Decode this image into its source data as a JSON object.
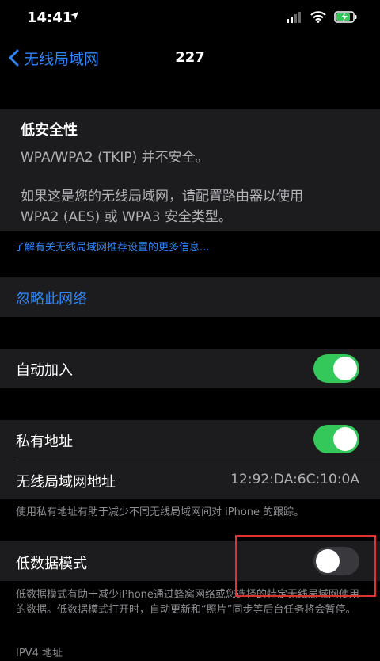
{
  "status_bar": {
    "time": "14:41",
    "location_icon": "location-arrow-icon",
    "signal_icon": "cellular-signal-icon",
    "wifi_icon": "wifi-icon",
    "battery_icon": "battery-charging-icon"
  },
  "nav": {
    "back_label": "无线局域网",
    "title": "227"
  },
  "security_warning": {
    "title": "低安全性",
    "line1": "WPA/WPA2 (TKIP) 并不安全。",
    "line2": "如果这是您的无线局域网，请配置路由器以使用",
    "line3": "WPA2 (AES) 或 WPA3 安全类型。"
  },
  "more_info_link": "了解有关无线局域网推荐设置的更多信息...",
  "forget_network": "忽略此网络",
  "auto_join": {
    "label": "自动加入",
    "enabled": true
  },
  "private_address": {
    "label": "私有地址",
    "enabled": true,
    "wifi_address_label": "无线局域网地址",
    "wifi_address_value": "12:92:DA:6C:10:0A",
    "footnote": "使用私有地址有助于减少不同无线局域网间对 iPhone 的跟踪。"
  },
  "low_data_mode": {
    "label": "低数据模式",
    "enabled": false,
    "footnote": "低数据模式有助于减少iPhone通过蜂窝网络或您选择的特定无线局域网使用的数据。低数据模式打开时，自动更新和“照片”同步等后台任务将会暂停。"
  },
  "next_section_header": "IPV4 地址",
  "colors": {
    "accent": "#2f86f6",
    "toggle_on": "#34c759",
    "toggle_off": "#39393d",
    "highlight": "#e0322f"
  }
}
